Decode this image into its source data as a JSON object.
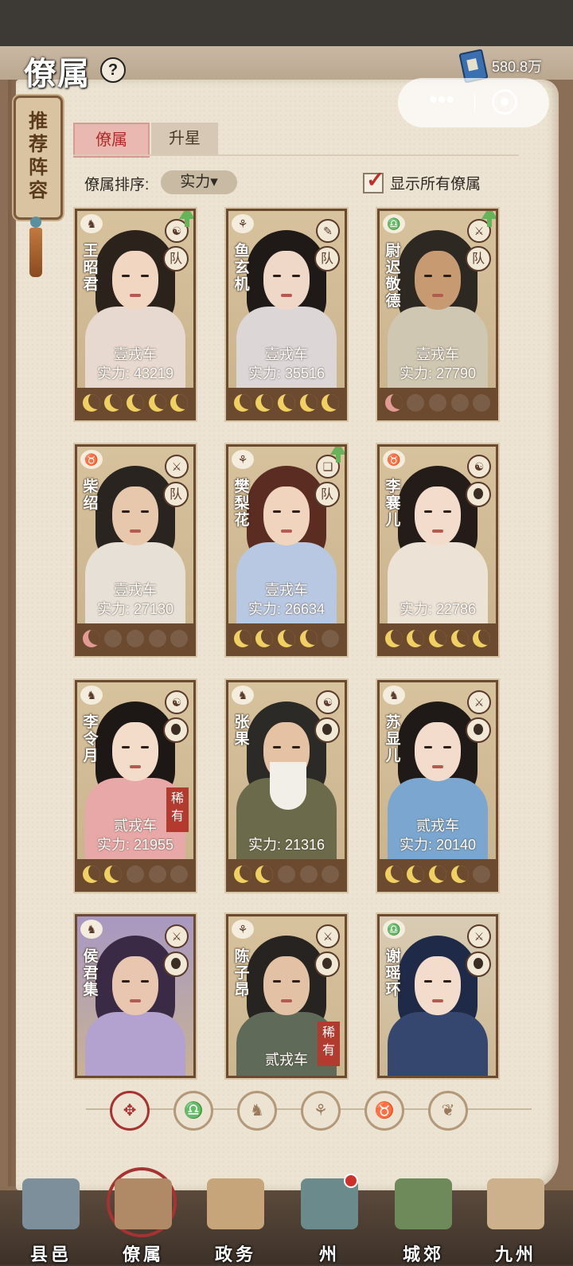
{
  "header": {
    "title": "僚属",
    "currency_value": "580.8万"
  },
  "side_tag": {
    "text": "推荐阵容"
  },
  "tabs": [
    {
      "label": "僚属",
      "active": true
    },
    {
      "label": "升星",
      "active": false
    }
  ],
  "sort": {
    "label": "僚属排序:",
    "value": "实力"
  },
  "show_all": {
    "label": "显示所有僚属",
    "checked": true
  },
  "cards": [
    {
      "name": "王昭君",
      "rank": "壹戎车",
      "power_label": "实力:",
      "power": "43219",
      "moons": [
        "on",
        "on",
        "on",
        "on",
        "on"
      ],
      "badge": "队",
      "upgrade": true,
      "faction_icon": "horse-icon",
      "role_icon": "yinyang-icon",
      "hair": "#2b221c",
      "robe": "#e7d9cf",
      "skin": "#f1d6c2"
    },
    {
      "name": "鱼玄机",
      "rank": "壹戎车",
      "power_label": "实力:",
      "power": "35516",
      "moons": [
        "on",
        "on",
        "on",
        "on",
        "on"
      ],
      "badge": "队",
      "upgrade": false,
      "faction_icon": "fan-icon",
      "role_icon": "brush-icon",
      "hair": "#1f1a17",
      "robe": "#dcd6d6",
      "skin": "#f0d8c8"
    },
    {
      "name": "尉迟敬德",
      "rank": "壹戎车",
      "power_label": "实力:",
      "power": "27790",
      "moons": [
        "pink",
        "off",
        "off",
        "off",
        "off"
      ],
      "badge": "队",
      "upgrade": true,
      "faction_icon": "bell-icon",
      "role_icon": "sword-icon",
      "hair": "#2e2822",
      "robe": "#cfc7b2",
      "skin": "#c79a72"
    },
    {
      "name": "柴绍",
      "rank": "壹戎车",
      "power_label": "实力:",
      "power": "27130",
      "moons": [
        "pink",
        "off",
        "off",
        "off",
        "off"
      ],
      "badge": "队",
      "upgrade": false,
      "faction_icon": "tiger-icon",
      "role_icon": "sword-icon",
      "hair": "#2a2420",
      "robe": "#e6e0d6",
      "skin": "#e7c8ad"
    },
    {
      "name": "樊梨花",
      "rank": "壹戎车",
      "power_label": "实力:",
      "power": "26634",
      "moons": [
        "on",
        "on",
        "on",
        "on",
        "off"
      ],
      "badge": "队",
      "upgrade": true,
      "faction_icon": "fan-icon",
      "role_icon": "book-icon",
      "hair": "#5a2c22",
      "robe": "#b9c8e2",
      "skin": "#f0d4bd"
    },
    {
      "name": "李褰儿",
      "rank": "",
      "power_label": "实力:",
      "power": "22786",
      "moons": [
        "on",
        "on",
        "on",
        "on",
        "on"
      ],
      "badge": "avatar",
      "upgrade": false,
      "faction_icon": "tiger-icon",
      "role_icon": "yinyang-icon",
      "hair": "#241c18",
      "robe": "#ece2d6",
      "skin": "#f3dccb"
    },
    {
      "name": "李令月",
      "rank": "贰戎车",
      "power_label": "实力:",
      "power": "21955",
      "moons": [
        "on",
        "on",
        "off",
        "off",
        "off"
      ],
      "badge": "avatar",
      "upgrade": false,
      "rare": "稀有",
      "faction_icon": "horse-icon",
      "role_icon": "yinyang-icon",
      "hair": "#1d1815",
      "robe": "#e8a8a8",
      "skin": "#f3dcc9"
    },
    {
      "name": "张果",
      "rank": "",
      "power_label": "实力:",
      "power": "21316",
      "moons": [
        "on",
        "on",
        "off",
        "off",
        "off"
      ],
      "badge": "avatar",
      "upgrade": false,
      "faction_icon": "horse-icon",
      "role_icon": "yinyang-icon",
      "hair": "#2c2a26",
      "robe": "#6b6a4a",
      "skin": "#e6c2a4",
      "beard": true
    },
    {
      "name": "苏显儿",
      "rank": "贰戎车",
      "power_label": "实力:",
      "power": "20140",
      "moons": [
        "on",
        "on",
        "on",
        "on",
        "off"
      ],
      "badge": "avatar",
      "upgrade": false,
      "faction_icon": "horse-icon",
      "role_icon": "sword-icon",
      "hair": "#1f1a18",
      "robe": "#7aa6cf",
      "skin": "#f3dccb"
    },
    {
      "name": "侯君集",
      "rank": "",
      "power_label": "",
      "power": "",
      "moons": [],
      "badge": "avatar",
      "upgrade": false,
      "faction_icon": "horse-icon",
      "role_icon": "sword-icon",
      "hair": "#3b2a46",
      "robe": "#b3a2cf",
      "skin": "#e8c6b0",
      "bg": "#a898c2"
    },
    {
      "name": "陈子昂",
      "rank": "贰戎车",
      "power_label": "",
      "power": "",
      "moons": [],
      "badge": "avatar",
      "upgrade": false,
      "rare": "稀有",
      "faction_icon": "fan-icon",
      "role_icon": "sword-icon",
      "hair": "#272320",
      "robe": "#5f6a58",
      "skin": "#e2c1a4"
    },
    {
      "name": "谢瑶环",
      "rank": "",
      "power_label": "",
      "power": "",
      "moons": [],
      "badge": "avatar",
      "upgrade": false,
      "faction_icon": "bell-icon",
      "role_icon": "sword-icon",
      "hair": "#1f2a48",
      "robe": "#35476e",
      "skin": "#f3dccb",
      "bg": "#d9ccb4"
    }
  ],
  "filters": [
    {
      "icon": "all-icon",
      "glyph": "✥",
      "active": true
    },
    {
      "icon": "bell-icon",
      "glyph": "♎",
      "active": false
    },
    {
      "icon": "horse-icon",
      "glyph": "♞",
      "active": false
    },
    {
      "icon": "fan-icon",
      "glyph": "⚘",
      "active": false
    },
    {
      "icon": "tiger-icon",
      "glyph": "♉",
      "active": false
    },
    {
      "icon": "leaf-icon",
      "glyph": "❦",
      "active": false
    }
  ],
  "nav": [
    {
      "label": "县邑",
      "icon": "town-icon",
      "color": "#7c8f9a"
    },
    {
      "label": "僚属",
      "icon": "officials-icon",
      "color": "#b08a66",
      "active": true
    },
    {
      "label": "政务",
      "icon": "affairs-icon",
      "color": "#c7a57a"
    },
    {
      "label": "州",
      "icon": "province-icon",
      "color": "#6a8a8c",
      "dot": true
    },
    {
      "label": "城郊",
      "icon": "suburb-icon",
      "color": "#6f8a5a"
    },
    {
      "label": "九州",
      "icon": "map-icon",
      "color": "#cdb18c"
    }
  ]
}
